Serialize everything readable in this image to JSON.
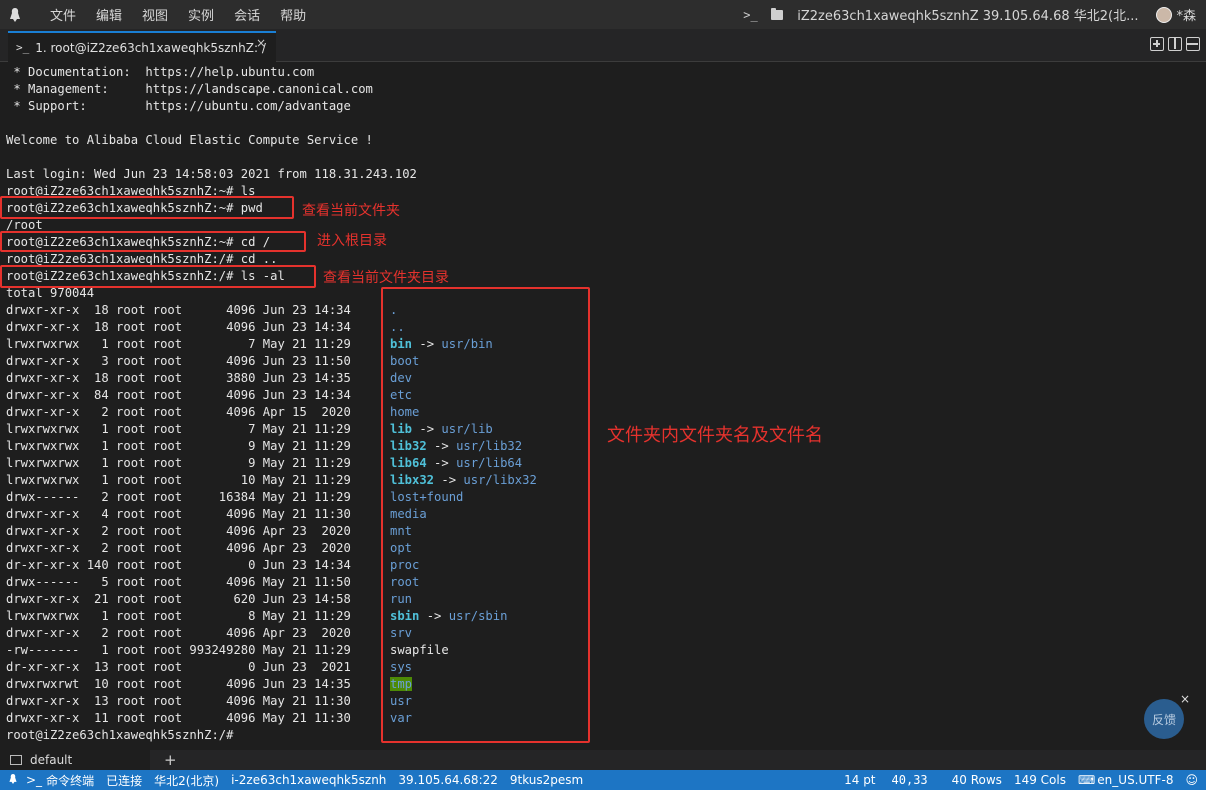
{
  "menubar": {
    "items": [
      "文件",
      "编辑",
      "视图",
      "实例",
      "会话",
      "帮助"
    ],
    "terminal_icon_label": ">_",
    "session_title": "iZ2ze63ch1xaweqhk5sznhZ 39.105.64.68 华北2(北...",
    "user": "*森"
  },
  "tab": {
    "prompt_icon": ">_",
    "title": "1. root@iZ2ze63ch1xaweqhk5sznhZ: /",
    "close": "×"
  },
  "terminal": {
    "lines": [
      " * Documentation:  https://help.ubuntu.com",
      " * Management:     https://landscape.canonical.com",
      " * Support:        https://ubuntu.com/advantage",
      "",
      "Welcome to Alibaba Cloud Elastic Compute Service !",
      "",
      "Last login: Wed Jun 23 14:58:03 2021 from 118.31.243.102",
      "root@iZ2ze63ch1xaweqhk5sznhZ:~# ls",
      "root@iZ2ze63ch1xaweqhk5sznhZ:~# pwd",
      "/root",
      "root@iZ2ze63ch1xaweqhk5sznhZ:~# cd /",
      "root@iZ2ze63ch1xaweqhk5sznhZ:/# cd ..",
      "root@iZ2ze63ch1xaweqhk5sznhZ:/# ls -al",
      "total 970044"
    ],
    "ls_rows": [
      {
        "meta": "drwxr-xr-x  18 root root      4096 Jun 23 14:34",
        "name": ".",
        "kind": "dir"
      },
      {
        "meta": "drwxr-xr-x  18 root root      4096 Jun 23 14:34",
        "name": "..",
        "kind": "dir"
      },
      {
        "meta": "lrwxrwxrwx   1 root root         7 May 21 11:29",
        "name": "bin",
        "target": "usr/bin",
        "kind": "link"
      },
      {
        "meta": "drwxr-xr-x   3 root root      4096 Jun 23 11:50",
        "name": "boot",
        "kind": "dir"
      },
      {
        "meta": "drwxr-xr-x  18 root root      3880 Jun 23 14:35",
        "name": "dev",
        "kind": "dir"
      },
      {
        "meta": "drwxr-xr-x  84 root root      4096 Jun 23 14:34",
        "name": "etc",
        "kind": "dir"
      },
      {
        "meta": "drwxr-xr-x   2 root root      4096 Apr 15  2020",
        "name": "home",
        "kind": "dir"
      },
      {
        "meta": "lrwxrwxrwx   1 root root         7 May 21 11:29",
        "name": "lib",
        "target": "usr/lib",
        "kind": "link"
      },
      {
        "meta": "lrwxrwxrwx   1 root root         9 May 21 11:29",
        "name": "lib32",
        "target": "usr/lib32",
        "kind": "link"
      },
      {
        "meta": "lrwxrwxrwx   1 root root         9 May 21 11:29",
        "name": "lib64",
        "target": "usr/lib64",
        "kind": "link"
      },
      {
        "meta": "lrwxrwxrwx   1 root root        10 May 21 11:29",
        "name": "libx32",
        "target": "usr/libx32",
        "kind": "link"
      },
      {
        "meta": "drwx------   2 root root     16384 May 21 11:29",
        "name": "lost+found",
        "kind": "dir"
      },
      {
        "meta": "drwxr-xr-x   4 root root      4096 May 21 11:30",
        "name": "media",
        "kind": "dir"
      },
      {
        "meta": "drwxr-xr-x   2 root root      4096 Apr 23  2020",
        "name": "mnt",
        "kind": "dir"
      },
      {
        "meta": "drwxr-xr-x   2 root root      4096 Apr 23  2020",
        "name": "opt",
        "kind": "dir"
      },
      {
        "meta": "dr-xr-xr-x 140 root root         0 Jun 23 14:34",
        "name": "proc",
        "kind": "dir"
      },
      {
        "meta": "drwx------   5 root root      4096 May 21 11:50",
        "name": "root",
        "kind": "dir"
      },
      {
        "meta": "drwxr-xr-x  21 root root       620 Jun 23 14:58",
        "name": "run",
        "kind": "dir"
      },
      {
        "meta": "lrwxrwxrwx   1 root root         8 May 21 11:29",
        "name": "sbin",
        "target": "usr/sbin",
        "kind": "link"
      },
      {
        "meta": "drwxr-xr-x   2 root root      4096 Apr 23  2020",
        "name": "srv",
        "kind": "dir"
      },
      {
        "meta": "-rw-------   1 root root 993249280 May 21 11:29",
        "name": "swapfile",
        "kind": "file"
      },
      {
        "meta": "dr-xr-xr-x  13 root root         0 Jun 23  2021",
        "name": "sys",
        "kind": "dir"
      },
      {
        "meta": "drwxrwxrwt  10 root root      4096 Jun 23 14:35",
        "name": "tmp",
        "kind": "tmp"
      },
      {
        "meta": "drwxr-xr-x  13 root root      4096 May 21 11:30",
        "name": "usr",
        "kind": "dir"
      },
      {
        "meta": "drwxr-xr-x  11 root root      4096 May 21 11:30",
        "name": "var",
        "kind": "dir"
      }
    ],
    "final_prompt": "root@iZ2ze63ch1xaweqhk5sznhZ:/#",
    "arrow": "->"
  },
  "annotations": {
    "pwd_note": "查看当前文件夹",
    "cd_note": "进入根目录",
    "ls_note": "查看当前文件夹目录",
    "names_note": "文件夹内文件夹名及文件名"
  },
  "feedback": {
    "label": "反馈",
    "close": "×"
  },
  "sessionbar": {
    "name": "default",
    "add": "+"
  },
  "statusbar": {
    "mode": "命令终端",
    "connected": "已连接",
    "region": "华北2(北京)",
    "instance": "i-2ze63ch1xaweqhk5sznh",
    "ip": "39.105.64.68:22",
    "code": "9tkus2pesm",
    "font_size": "14 pt",
    "cursor": "40,33",
    "rows": "40 Rows",
    "cols": "149 Cols",
    "encoding": "en_US.UTF-8"
  },
  "colors": {
    "accent": "#1d75c4",
    "annotation": "#e5322d",
    "dir": "#6a9fd6",
    "link": "#4fc0d8",
    "tmp_bg": "#4d8a06"
  }
}
